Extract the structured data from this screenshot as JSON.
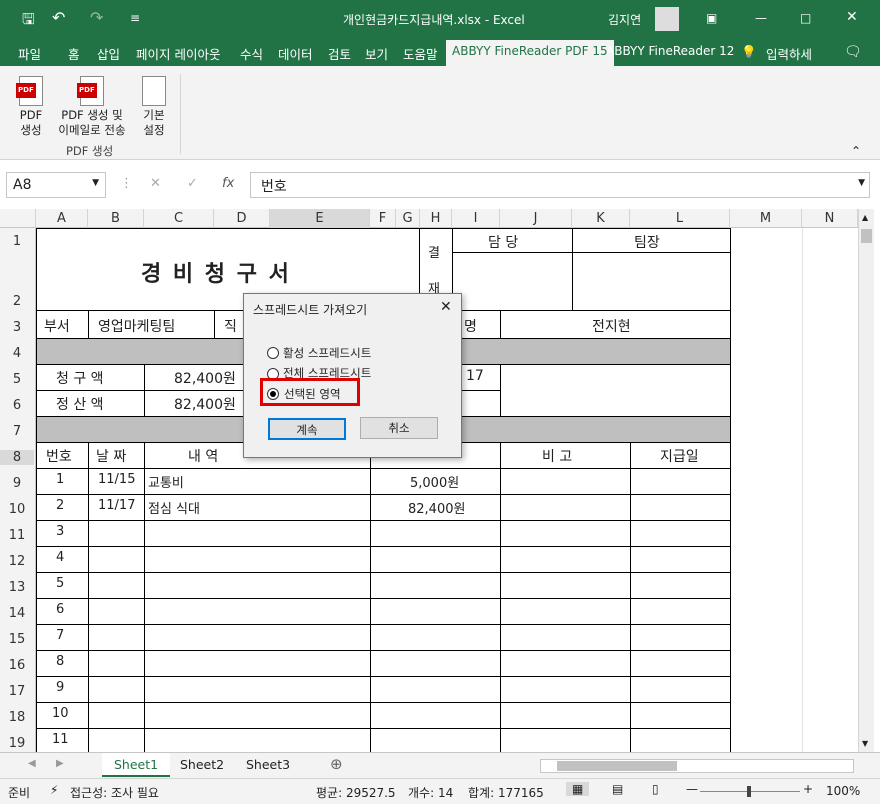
{
  "titlebar": {
    "filename": "개인현금카드지급내역.xlsx - Excel",
    "user": "김지연"
  },
  "tabs": [
    "파일",
    "홈",
    "삽입",
    "페이지 레이아웃",
    "수식",
    "데이터",
    "검토",
    "보기",
    "도움말",
    "ABBYY FineReader PDF 15",
    "ABBYY FineReader 12",
    "입력하세"
  ],
  "ribbon": {
    "btn1": "PDF\n생성",
    "btn2": "PDF 생성 및\n이메일로 전송",
    "btn3": "기본\n설정",
    "group": "PDF 생성",
    "icon": "PDF"
  },
  "formula": {
    "namebox": "A8",
    "content": "번호",
    "fx": "fx"
  },
  "columns": [
    "A",
    "B",
    "C",
    "D",
    "E",
    "F",
    "G",
    "H",
    "I",
    "J",
    "K",
    "L",
    "M",
    "N",
    "O"
  ],
  "rows": [
    "1",
    "2",
    "3",
    "4",
    "5",
    "6",
    "7",
    "8",
    "9",
    "10",
    "11",
    "12",
    "13",
    "14",
    "15",
    "16",
    "17",
    "18",
    "19"
  ],
  "sheet": {
    "title": "경 비 청 구 서",
    "gyeol": "결",
    "jae": "재",
    "damdang": "담  당",
    "timjang": "팀장",
    "buseo": "부서",
    "buseo_val": "영업마케팅팀",
    "jik": "직",
    "myeong": "명",
    "name_val": "전지현",
    "cheonggu": "청  구  액",
    "cheonggu_val": "82,400원",
    "jeongsan": "정  산  액",
    "jeongsan_val": "82,400원",
    "r5_partial": "17",
    "h_no": "번호",
    "h_date": "날  짜",
    "h_desc": "내      역",
    "h_bigo": "비      고",
    "h_jigeup": "지급일",
    "items": [
      {
        "no": "1",
        "date": "11/15",
        "desc": "교통비",
        "amount": "5,000원"
      },
      {
        "no": "2",
        "date": "11/17",
        "desc": "점심 식대",
        "amount": "82,400원"
      },
      {
        "no": "3"
      },
      {
        "no": "4"
      },
      {
        "no": "5"
      },
      {
        "no": "6"
      },
      {
        "no": "7"
      },
      {
        "no": "8"
      },
      {
        "no": "9"
      },
      {
        "no": "10"
      },
      {
        "no": "11"
      }
    ]
  },
  "dialog": {
    "title": "스프레드시트 가져오기",
    "opt1": "활성 스프레드시트",
    "opt2": "전체 스프레드시트",
    "opt3": "선택된 영역",
    "ok": "계속",
    "cancel": "취소"
  },
  "sheets": [
    "Sheet1",
    "Sheet2",
    "Sheet3"
  ],
  "status": {
    "ready": "준비",
    "access": "접근성: 조사 필요",
    "avg": "평균: 29527.5",
    "count": "개수: 14",
    "sum": "합계: 177165",
    "zoom": "100%"
  },
  "colors": {
    "excel_green": "#217346",
    "highlight_red": "#e00000"
  }
}
